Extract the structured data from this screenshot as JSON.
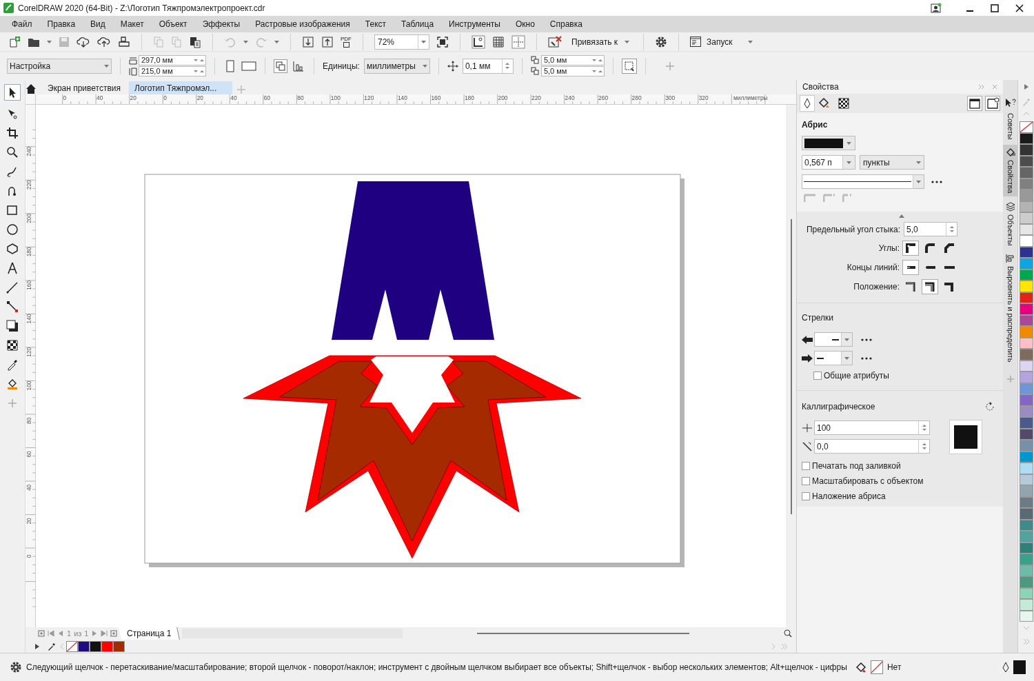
{
  "window": {
    "title": "CorelDRAW 2020 (64-Bit) - Z:\\Логотип Тяжпромэлектропроект.cdr"
  },
  "menu": [
    "Файл",
    "Правка",
    "Вид",
    "Макет",
    "Объект",
    "Эффекты",
    "Растровые изображения",
    "Текст",
    "Таблица",
    "Инструменты",
    "Окно",
    "Справка"
  ],
  "toolbar": {
    "pdf_label": "PDF",
    "zoom": "72%",
    "snap": "Привязать к",
    "launch": "Запуск"
  },
  "property_bar": {
    "preset": "Настройка",
    "page_width": "297,0 мм",
    "page_height": "215,0 мм",
    "units_label": "Единицы:",
    "units": "миллиметры",
    "nudge": "0,1 мм",
    "duplicate_x": "5,0 мм",
    "duplicate_y": "5,0 мм"
  },
  "doc_tabs": [
    {
      "label": "Экран приветствия",
      "selected": false
    },
    {
      "label": "Логотип Тяжпромэл...",
      "selected": true
    }
  ],
  "rulers": {
    "horizontal": [
      "0",
      "40",
      "20",
      "0",
      "20",
      "40",
      "60",
      "80",
      "100",
      "120",
      "140",
      "160",
      "180",
      "200",
      "220",
      "240",
      "260",
      "280",
      "300",
      "320"
    ],
    "unit": "миллиметры",
    "vertical": [
      "240",
      "220",
      "200",
      "180",
      "160",
      "140",
      "120",
      "100",
      "80",
      "60",
      "40",
      "20",
      "0"
    ]
  },
  "page_nav": {
    "current": "1",
    "of": "из",
    "total": "1",
    "tab": "Страница 1"
  },
  "document_palette": [
    {
      "kind": "none"
    },
    {
      "kind": "swatch",
      "color": "#1f0a80"
    },
    {
      "kind": "swatch",
      "color": "#111111"
    },
    {
      "kind": "swatch",
      "color": "#ff0000"
    },
    {
      "kind": "swatch",
      "color": "#a52a00"
    }
  ],
  "docker": {
    "title": "Свойства",
    "outline": "Абрис",
    "width": "0,567 п",
    "width_units": "пункты",
    "miter_label": "Предельный угол стыка:",
    "miter": "5,0",
    "corners_label": "Углы:",
    "corners": [
      {
        "selected": true
      },
      {
        "selected": false
      },
      {
        "selected": false
      }
    ],
    "caps_label": "Концы линий:",
    "caps": [
      {
        "selected": true
      },
      {
        "selected": false
      },
      {
        "selected": false
      }
    ],
    "position_label": "Положение:",
    "positions": [
      {
        "selected": false
      },
      {
        "selected": true
      },
      {
        "selected": false
      }
    ],
    "arrows": "Стрелки",
    "shared": {
      "label": "Общие атрибуты",
      "checked": false
    },
    "calligraphic": "Каллиграфическое",
    "stretch": "100",
    "angle": "0,0",
    "options": [
      {
        "label": "Печатать под заливкой",
        "checked": false
      },
      {
        "label": "Масштабировать с объектом",
        "checked": false
      },
      {
        "label": "Наложение абриса",
        "checked": false
      }
    ]
  },
  "dock_tabs": [
    {
      "label": "Советы",
      "selected": false
    },
    {
      "label": "Свойства",
      "selected": true
    },
    {
      "label": "Объекты",
      "selected": false
    },
    {
      "label": "Выровнять и распределить",
      "selected": false
    }
  ],
  "palette": [
    {
      "kind": "none"
    },
    {
      "kind": "swatch",
      "color": "#1a1a1a"
    },
    {
      "kind": "swatch",
      "color": "#333333"
    },
    {
      "kind": "swatch",
      "color": "#4d4d4d"
    },
    {
      "kind": "swatch",
      "color": "#666666"
    },
    {
      "kind": "swatch",
      "color": "#808080"
    },
    {
      "kind": "swatch",
      "color": "#999999"
    },
    {
      "kind": "swatch",
      "color": "#b3b3b3"
    },
    {
      "kind": "swatch",
      "color": "#cccccc"
    },
    {
      "kind": "swatch",
      "color": "#e6e6e6"
    },
    {
      "kind": "swatch",
      "color": "#ffffff"
    },
    {
      "kind": "swatch",
      "color": "#2e3192"
    },
    {
      "kind": "swatch",
      "color": "#0ea5e0"
    },
    {
      "kind": "swatch",
      "color": "#00a650"
    },
    {
      "kind": "swatch",
      "color": "#ffe600"
    },
    {
      "kind": "swatch",
      "color": "#e2231a"
    },
    {
      "kind": "swatch",
      "color": "#e6007e"
    },
    {
      "kind": "swatch",
      "color": "#a9479a"
    },
    {
      "kind": "swatch",
      "color": "#f08a00"
    },
    {
      "kind": "swatch",
      "color": "#ffbec8"
    },
    {
      "kind": "swatch",
      "color": "#7d6b60"
    },
    {
      "kind": "swatch",
      "color": "#dcd4f0"
    },
    {
      "kind": "swatch",
      "color": "#b3a3e0"
    },
    {
      "kind": "swatch",
      "color": "#7094d8"
    },
    {
      "kind": "swatch",
      "color": "#8565c8"
    },
    {
      "kind": "swatch",
      "color": "#9a8cc0"
    },
    {
      "kind": "swatch",
      "color": "#4a5a8a"
    },
    {
      "kind": "swatch",
      "color": "#534a6a"
    },
    {
      "kind": "swatch",
      "color": "#7890a6"
    },
    {
      "kind": "swatch",
      "color": "#0096d2"
    },
    {
      "kind": "swatch",
      "color": "#aedcf2"
    },
    {
      "kind": "swatch",
      "color": "#b4cad8"
    },
    {
      "kind": "swatch",
      "color": "#93a4ae"
    },
    {
      "kind": "swatch",
      "color": "#6b7c86"
    },
    {
      "kind": "swatch",
      "color": "#5a6a72"
    },
    {
      "kind": "swatch",
      "color": "#3f8a8a"
    },
    {
      "kind": "swatch",
      "color": "#52a3a0"
    },
    {
      "kind": "swatch",
      "color": "#2e8078"
    },
    {
      "kind": "swatch",
      "color": "#3aa08a"
    },
    {
      "kind": "swatch",
      "color": "#6cbca8"
    },
    {
      "kind": "swatch",
      "color": "#4a9a80"
    },
    {
      "kind": "swatch",
      "color": "#8ed2b8"
    },
    {
      "kind": "swatch",
      "color": "#c4ead8"
    },
    {
      "kind": "swatch",
      "color": "#e6f5ee"
    }
  ],
  "status": {
    "hint": "Следующий щелчок - перетаскивание/масштабирование; второй щелчок - поворот/наклон; инструмент с двойным щелчком выбирает все объекты; Shift+щелчок - выбор нескольких элементов; Alt+щелчок - цифры",
    "fill": "Нет"
  }
}
